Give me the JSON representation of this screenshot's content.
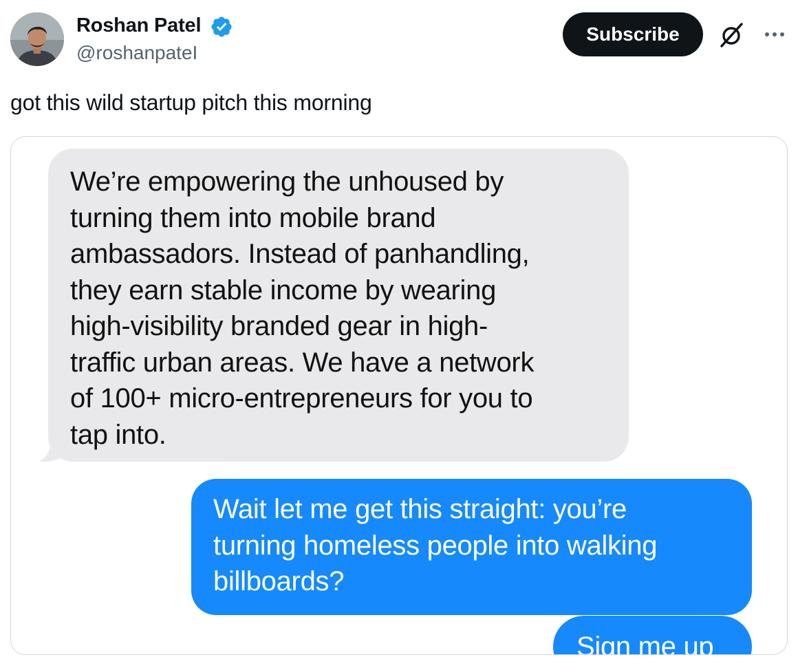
{
  "author": {
    "name": "Roshan Patel",
    "handle": "@roshanpateI",
    "verified": true,
    "verified_color": "#1d9bf0"
  },
  "actions": {
    "subscribe_label": "Subscribe",
    "grok_icon": "grok-icon",
    "more_icon": "more-horizontal-icon"
  },
  "post": {
    "text": "got this wild startup pitch this morning"
  },
  "messages": {
    "received": {
      "lines": [
        "We’re empowering the unhoused by",
        "turning them into mobile brand",
        "ambassadors. Instead of panhandling,",
        "they earn stable income by wearing",
        "high-visibility branded gear in high-",
        "traffic urban areas. We have a network",
        "of 100+ micro-entrepreneurs for you to",
        "tap into."
      ],
      "bubble_color": "#e9e9eb"
    },
    "sent": {
      "lines": [
        "Wait let me get this straight: you’re",
        "turning homeless people into walking",
        "billboards?"
      ],
      "bubble_color": "#1689fc"
    },
    "sent_2": {
      "text": "Sign me up"
    }
  },
  "colors": {
    "text_primary": "#0f1419",
    "text_secondary": "#536471",
    "border": "#cfd9de"
  }
}
